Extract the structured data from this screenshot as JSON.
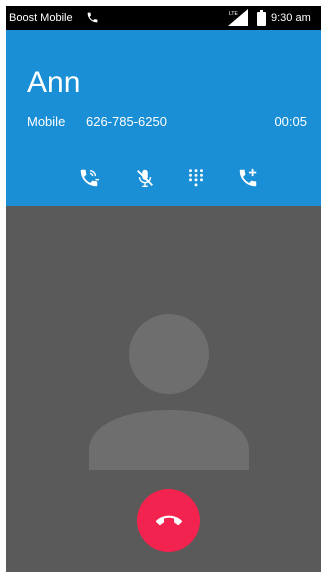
{
  "status_bar": {
    "carrier": "Boost Mobile",
    "time": "9:30 am",
    "carrier_icon": "phone-in-call-icon",
    "signal_icon": "signal-icon",
    "battery_icon": "battery-icon"
  },
  "call": {
    "caller_name": "Ann",
    "number_type": "Mobile",
    "phone_number": "626-785-6250",
    "duration": "00:05"
  },
  "controls": [
    {
      "name": "switch-audio",
      "icon": "phone-transfer-icon"
    },
    {
      "name": "mute",
      "icon": "mic-off-icon"
    },
    {
      "name": "dialpad",
      "icon": "dialpad-icon"
    },
    {
      "name": "add-call",
      "icon": "add-call-icon"
    }
  ],
  "end_call": {
    "icon": "call-end-icon"
  },
  "colors": {
    "header": "#1a8fd5",
    "background": "#5a5a5a",
    "end_call": "#f2244f",
    "avatar": "#6e6e6e"
  }
}
